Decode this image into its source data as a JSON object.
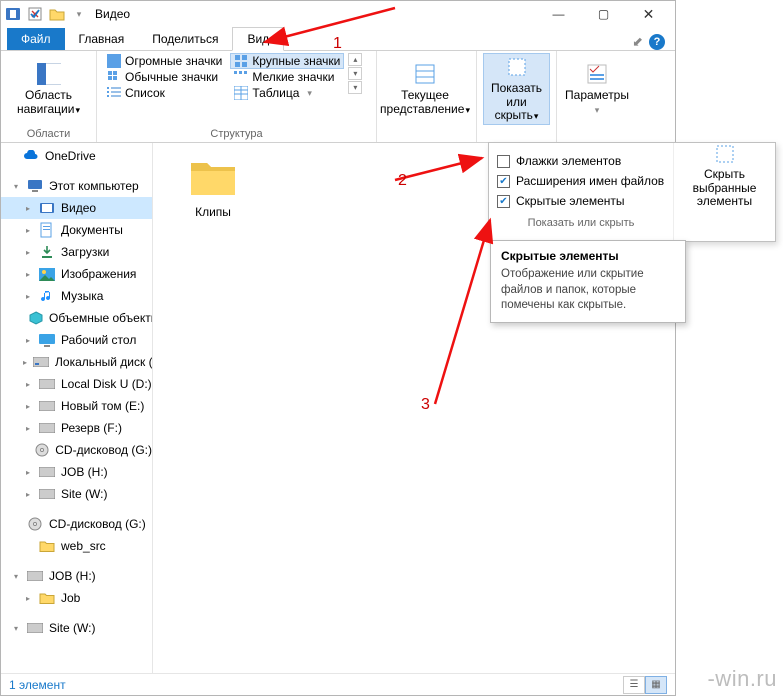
{
  "titlebar": {
    "title": "Видео"
  },
  "sys": {
    "min": "—",
    "max": "▢",
    "close": "✕"
  },
  "tabs": {
    "file": "Файл",
    "home": "Главная",
    "share": "Поделиться",
    "view": "Вид",
    "pin": "📌"
  },
  "ribbon": {
    "panes_group": "Области",
    "nav_pane": "Область навигации",
    "layout_group": "Структура",
    "views": {
      "huge": "Огромные значки",
      "large": "Крупные значки",
      "medium": "Обычные значки",
      "small": "Мелкие значки",
      "list": "Список",
      "table": "Таблица"
    },
    "current_view": "Текущее представление",
    "show_hide_btn": "Показать или скрыть",
    "options_btn": "Параметры"
  },
  "popup": {
    "check_flags": "Флажки элементов",
    "check_extensions": "Расширения имен файлов",
    "check_hidden": "Скрытые элементы",
    "hide_selected": "Скрыть выбранные элементы",
    "caption": "Показать или скрыть"
  },
  "tooltip": {
    "title": "Скрытые элементы",
    "body": "Отображение или скрытие файлов и папок, которые помечены как скрытые."
  },
  "nav": {
    "onedrive": "OneDrive",
    "thispc": "Этот компьютер",
    "videos": "Видео",
    "documents": "Документы",
    "downloads": "Загрузки",
    "pictures": "Изображения",
    "music": "Музыка",
    "objects3d": "Объемные объекты",
    "desktop": "Рабочий стол",
    "localdisk": "Локальный диск (C:)",
    "localu": "Local Disk U (D:)",
    "newvol": "Новый том (E:)",
    "reserve": "Резерв (F:)",
    "cddrive": "CD-дисковод (G:)",
    "job": "JOB (H:)",
    "site": "Site (W:)",
    "cd2": "CD-дисковод (G:)",
    "websrc": "web_src",
    "job2": "JOB (H:)",
    "jobchild": "Job",
    "site2": "Site (W:)"
  },
  "content": {
    "clips": "Клипы"
  },
  "status": {
    "count": "1 элемент"
  },
  "annot": {
    "n1": "1",
    "n2": "2",
    "n3": "3"
  },
  "watermark": "-win.ru"
}
